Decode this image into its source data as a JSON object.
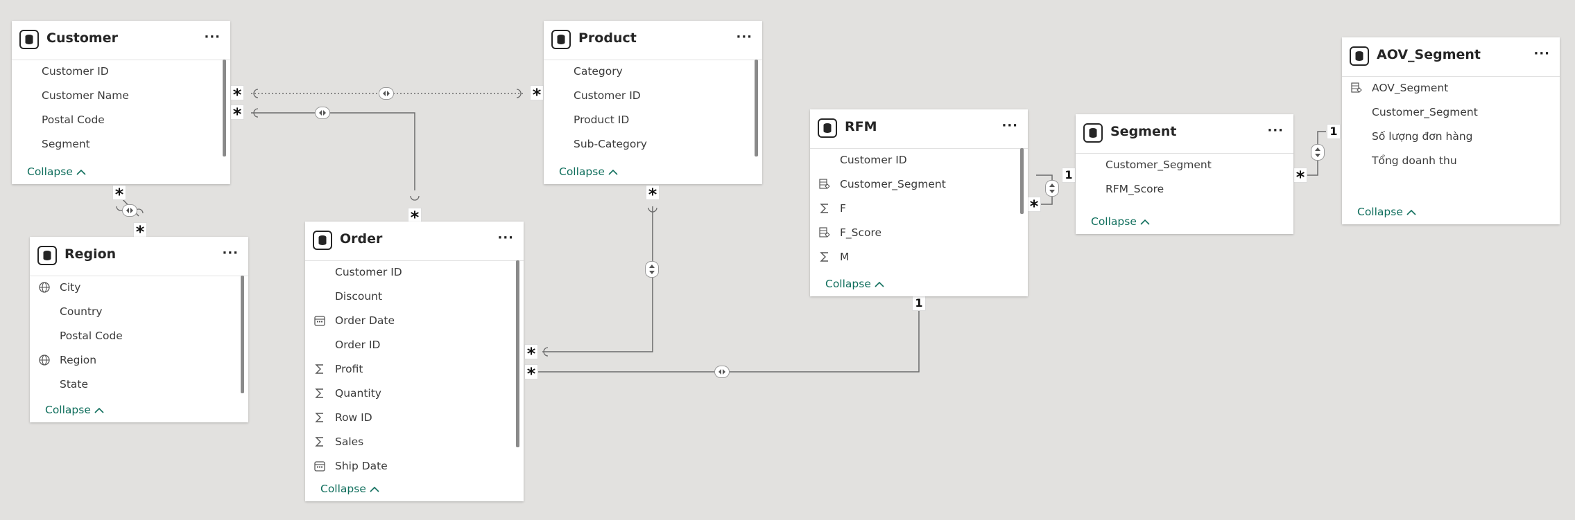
{
  "tables": [
    {
      "key": "customer",
      "title": "Customer",
      "more_label": "···",
      "collapse_label": "Collapse",
      "fields": [
        {
          "name": "Customer ID",
          "icon": "none"
        },
        {
          "name": "Customer Name",
          "icon": "none"
        },
        {
          "name": "Postal Code",
          "icon": "none"
        },
        {
          "name": "Segment",
          "icon": "none"
        }
      ]
    },
    {
      "key": "product",
      "title": "Product",
      "more_label": "···",
      "collapse_label": "Collapse",
      "fields": [
        {
          "name": "Category",
          "icon": "none"
        },
        {
          "name": "Customer ID",
          "icon": "none"
        },
        {
          "name": "Product ID",
          "icon": "none"
        },
        {
          "name": "Sub-Category",
          "icon": "none"
        }
      ]
    },
    {
      "key": "region",
      "title": "Region",
      "more_label": "···",
      "collapse_label": "Collapse",
      "fields": [
        {
          "name": "City",
          "icon": "globe-icon"
        },
        {
          "name": "Country",
          "icon": "none"
        },
        {
          "name": "Postal Code",
          "icon": "none"
        },
        {
          "name": "Region",
          "icon": "globe-icon"
        },
        {
          "name": "State",
          "icon": "none"
        }
      ]
    },
    {
      "key": "order",
      "title": "Order",
      "more_label": "···",
      "collapse_label": "Collapse",
      "fields": [
        {
          "name": "Customer ID",
          "icon": "none"
        },
        {
          "name": "Discount",
          "icon": "none"
        },
        {
          "name": "Order Date",
          "icon": "calendar-icon"
        },
        {
          "name": "Order ID",
          "icon": "none"
        },
        {
          "name": "Profit",
          "icon": "sigma-icon"
        },
        {
          "name": "Quantity",
          "icon": "sigma-icon"
        },
        {
          "name": "Row ID",
          "icon": "sigma-icon"
        },
        {
          "name": "Sales",
          "icon": "sigma-icon"
        },
        {
          "name": "Ship Date",
          "icon": "calendar-icon"
        }
      ]
    },
    {
      "key": "rfm",
      "title": "RFM",
      "more_label": "···",
      "collapse_label": "Collapse",
      "fields": [
        {
          "name": "Customer ID",
          "icon": "none"
        },
        {
          "name": "Customer_Segment",
          "icon": "calculated-column-icon"
        },
        {
          "name": "F",
          "icon": "sigma-icon"
        },
        {
          "name": "F_Score",
          "icon": "calculated-column-icon"
        },
        {
          "name": "M",
          "icon": "sigma-icon"
        }
      ]
    },
    {
      "key": "segment",
      "title": "Segment",
      "more_label": "···",
      "collapse_label": "Collapse",
      "fields": [
        {
          "name": "Customer_Segment",
          "icon": "none"
        },
        {
          "name": "RFM_Score",
          "icon": "none"
        }
      ]
    },
    {
      "key": "aov_segment",
      "title": "AOV_Segment",
      "more_label": "···",
      "collapse_label": "Collapse",
      "fields": [
        {
          "name": "AOV_Segment",
          "icon": "calculated-column-icon"
        },
        {
          "name": "Customer_Segment",
          "icon": "none"
        },
        {
          "name": "Số lượng đơn hàng",
          "icon": "none"
        },
        {
          "name": "Tổng doanh thu",
          "icon": "none"
        }
      ]
    }
  ],
  "relationships": [
    {
      "from": "customer",
      "to": "product",
      "from_cardinality": "*",
      "to_cardinality": "*",
      "cross_filter": "both",
      "active": false
    },
    {
      "from": "customer",
      "to": "order",
      "from_cardinality": "*",
      "to_cardinality": "*",
      "cross_filter": "both",
      "active": true
    },
    {
      "from": "customer",
      "to": "region",
      "from_cardinality": "*",
      "to_cardinality": "*",
      "cross_filter": "both",
      "active": true
    },
    {
      "from": "product",
      "to": "order",
      "from_cardinality": "*",
      "to_cardinality": "*",
      "cross_filter": "both",
      "active": true
    },
    {
      "from": "rfm",
      "to": "order",
      "from_cardinality": "1",
      "to_cardinality": "*",
      "cross_filter": "both",
      "active": true
    },
    {
      "from": "segment",
      "to": "rfm",
      "from_cardinality": "1",
      "to_cardinality": "*",
      "cross_filter": "both",
      "active": true
    },
    {
      "from": "aov_segment",
      "to": "segment",
      "from_cardinality": "1",
      "to_cardinality": "*",
      "cross_filter": "both",
      "active": true
    }
  ],
  "colors": {
    "canvas": "#e2e1df",
    "card": "#ffffff",
    "collapse_link": "#0f6e5c",
    "line": "#6b6b6b"
  }
}
